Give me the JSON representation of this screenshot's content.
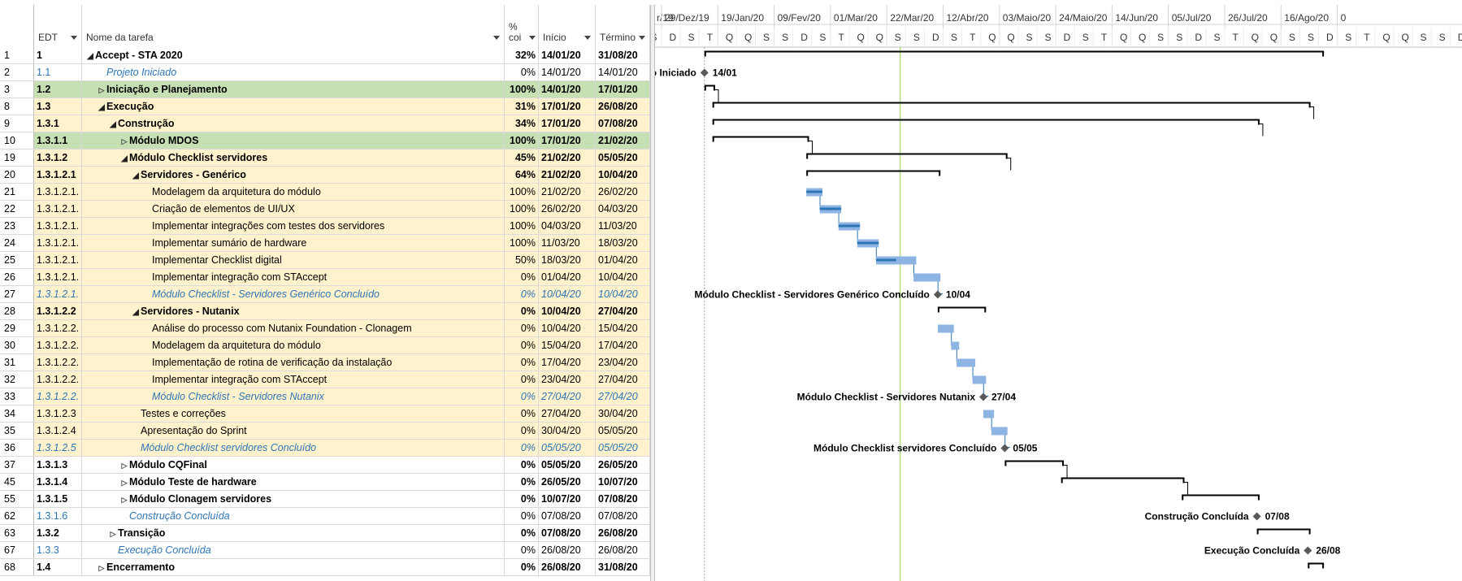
{
  "table": {
    "headers": {
      "id": "",
      "edt": "EDT",
      "name": "Nome da tarefa",
      "pct_top": "%",
      "pct_bottom": "coi",
      "start": "Início",
      "end": "Término"
    },
    "rows": [
      {
        "id": "1",
        "edt": "1",
        "name": "Accept - STA 2020",
        "pct": "32%",
        "start": "14/01/20",
        "end": "31/08/20",
        "level": 0,
        "bold": true,
        "expander": "open",
        "bg": "#ffffff",
        "type": "summary"
      },
      {
        "id": "2",
        "edt": "1.1",
        "name": "Projeto Iniciado",
        "pct": "0%",
        "start": "14/01/20",
        "end": "14/01/20",
        "level": 1,
        "bold": false,
        "expander": "",
        "bg": "#ffffff",
        "type": "milestone-plain"
      },
      {
        "id": "3",
        "edt": "1.2",
        "name": "Iniciação e Planejamento",
        "pct": "100%",
        "start": "14/01/20",
        "end": "17/01/20",
        "level": 1,
        "bold": true,
        "expander": "closed",
        "bg": "#c6e0b4",
        "type": "summary"
      },
      {
        "id": "8",
        "edt": "1.3",
        "name": "Execução",
        "pct": "31%",
        "start": "17/01/20",
        "end": "26/08/20",
        "level": 1,
        "bold": true,
        "expander": "open",
        "bg": "#fff2cc",
        "type": "summary"
      },
      {
        "id": "9",
        "edt": "1.3.1",
        "name": "Construção",
        "pct": "34%",
        "start": "17/01/20",
        "end": "07/08/20",
        "level": 2,
        "bold": true,
        "expander": "open",
        "bg": "#fff2cc",
        "type": "summary"
      },
      {
        "id": "10",
        "edt": "1.3.1.1",
        "name": "Módulo MDOS",
        "pct": "100%",
        "start": "17/01/20",
        "end": "21/02/20",
        "level": 3,
        "bold": true,
        "expander": "closed",
        "bg": "#c6e0b4",
        "type": "summary"
      },
      {
        "id": "19",
        "edt": "1.3.1.2",
        "name": "Módulo Checklist servidores",
        "pct": "45%",
        "start": "21/02/20",
        "end": "05/05/20",
        "level": 3,
        "bold": true,
        "expander": "open",
        "bg": "#fff2cc",
        "type": "summary"
      },
      {
        "id": "20",
        "edt": "1.3.1.2.1",
        "name": "Servidores - Genérico",
        "pct": "64%",
        "start": "21/02/20",
        "end": "10/04/20",
        "level": 4,
        "bold": true,
        "expander": "open",
        "bg": "#fff2cc",
        "type": "summary"
      },
      {
        "id": "21",
        "edt": "1.3.1.2.1.",
        "name": "Modelagem da arquitetura do módulo",
        "pct": "100%",
        "start": "21/02/20",
        "end": "26/02/20",
        "level": 5,
        "bold": false,
        "expander": "",
        "bg": "#fff2cc",
        "type": "task"
      },
      {
        "id": "22",
        "edt": "1.3.1.2.1.",
        "name": "Criação de elementos de UI/UX",
        "pct": "100%",
        "start": "26/02/20",
        "end": "04/03/20",
        "level": 5,
        "bold": false,
        "expander": "",
        "bg": "#fff2cc",
        "type": "task"
      },
      {
        "id": "23",
        "edt": "1.3.1.2.1.",
        "name": "Implementar integrações com testes dos servidores",
        "pct": "100%",
        "start": "04/03/20",
        "end": "11/03/20",
        "level": 5,
        "bold": false,
        "expander": "",
        "bg": "#fff2cc",
        "type": "task"
      },
      {
        "id": "24",
        "edt": "1.3.1.2.1.",
        "name": "Implementar sumário de hardware",
        "pct": "100%",
        "start": "11/03/20",
        "end": "18/03/20",
        "level": 5,
        "bold": false,
        "expander": "",
        "bg": "#fff2cc",
        "type": "task"
      },
      {
        "id": "25",
        "edt": "1.3.1.2.1.",
        "name": "Implementar Checklist digital",
        "pct": "50%",
        "start": "18/03/20",
        "end": "01/04/20",
        "level": 5,
        "bold": false,
        "expander": "",
        "bg": "#fff2cc",
        "type": "task"
      },
      {
        "id": "26",
        "edt": "1.3.1.2.1.",
        "name": "Implementar integração com STAccept",
        "pct": "0%",
        "start": "01/04/20",
        "end": "10/04/20",
        "level": 5,
        "bold": false,
        "expander": "",
        "bg": "#fff2cc",
        "type": "task"
      },
      {
        "id": "27",
        "edt": "1.3.1.2.1.",
        "name": "Módulo Checklist - Servidores Genérico Concluído",
        "pct": "0%",
        "start": "10/04/20",
        "end": "10/04/20",
        "level": 5,
        "bold": false,
        "expander": "",
        "bg": "#fff2cc",
        "type": "milestone"
      },
      {
        "id": "28",
        "edt": "1.3.1.2.2",
        "name": "Servidores - Nutanix",
        "pct": "0%",
        "start": "10/04/20",
        "end": "27/04/20",
        "level": 4,
        "bold": true,
        "expander": "open",
        "bg": "#fff2cc",
        "type": "summary"
      },
      {
        "id": "29",
        "edt": "1.3.1.2.2.",
        "name": "Análise do processo com Nutanix Foundation - Clonagem",
        "pct": "0%",
        "start": "10/04/20",
        "end": "15/04/20",
        "level": 5,
        "bold": false,
        "expander": "",
        "bg": "#fff2cc",
        "type": "task"
      },
      {
        "id": "30",
        "edt": "1.3.1.2.2.",
        "name": "Modelagem da arquitetura do módulo",
        "pct": "0%",
        "start": "15/04/20",
        "end": "17/04/20",
        "level": 5,
        "bold": false,
        "expander": "",
        "bg": "#fff2cc",
        "type": "task"
      },
      {
        "id": "31",
        "edt": "1.3.1.2.2.",
        "name": "Implementação de rotina de verificação da instalação",
        "pct": "0%",
        "start": "17/04/20",
        "end": "23/04/20",
        "level": 5,
        "bold": false,
        "expander": "",
        "bg": "#fff2cc",
        "type": "task"
      },
      {
        "id": "32",
        "edt": "1.3.1.2.2.",
        "name": "Implementar integração com STAccept",
        "pct": "0%",
        "start": "23/04/20",
        "end": "27/04/20",
        "level": 5,
        "bold": false,
        "expander": "",
        "bg": "#fff2cc",
        "type": "task"
      },
      {
        "id": "33",
        "edt": "1.3.1.2.2.",
        "name": "Módulo Checklist - Servidores Nutanix",
        "pct": "0%",
        "start": "27/04/20",
        "end": "27/04/20",
        "level": 5,
        "bold": false,
        "expander": "",
        "bg": "#fff2cc",
        "type": "milestone"
      },
      {
        "id": "34",
        "edt": "1.3.1.2.3",
        "name": "Testes e correções",
        "pct": "0%",
        "start": "27/04/20",
        "end": "30/04/20",
        "level": 4,
        "bold": false,
        "expander": "",
        "bg": "#fff2cc",
        "type": "task"
      },
      {
        "id": "35",
        "edt": "1.3.1.2.4",
        "name": "Apresentação do Sprint",
        "pct": "0%",
        "start": "30/04/20",
        "end": "05/05/20",
        "level": 4,
        "bold": false,
        "expander": "",
        "bg": "#fff2cc",
        "type": "task"
      },
      {
        "id": "36",
        "edt": "1.3.1.2.5",
        "name": "Módulo Checklist servidores Concluído",
        "pct": "0%",
        "start": "05/05/20",
        "end": "05/05/20",
        "level": 4,
        "bold": false,
        "expander": "",
        "bg": "#fff2cc",
        "type": "milestone"
      },
      {
        "id": "37",
        "edt": "1.3.1.3",
        "name": "Módulo CQFinal",
        "pct": "0%",
        "start": "05/05/20",
        "end": "26/05/20",
        "level": 3,
        "bold": true,
        "expander": "closed",
        "bg": "#ffffff",
        "type": "summary"
      },
      {
        "id": "45",
        "edt": "1.3.1.4",
        "name": "Módulo Teste de hardware",
        "pct": "0%",
        "start": "26/05/20",
        "end": "10/07/20",
        "level": 3,
        "bold": true,
        "expander": "closed",
        "bg": "#ffffff",
        "type": "summary"
      },
      {
        "id": "55",
        "edt": "1.3.1.5",
        "name": "Módulo Clonagem servidores",
        "pct": "0%",
        "start": "10/07/20",
        "end": "07/08/20",
        "level": 3,
        "bold": true,
        "expander": "closed",
        "bg": "#ffffff",
        "type": "summary"
      },
      {
        "id": "62",
        "edt": "1.3.1.6",
        "name": "Construção Concluída",
        "pct": "0%",
        "start": "07/08/20",
        "end": "07/08/20",
        "level": 3,
        "bold": false,
        "expander": "",
        "bg": "#ffffff",
        "type": "milestone-plain"
      },
      {
        "id": "63",
        "edt": "1.3.2",
        "name": "Transição",
        "pct": "0%",
        "start": "07/08/20",
        "end": "26/08/20",
        "level": 2,
        "bold": true,
        "expander": "closed",
        "bg": "#ffffff",
        "type": "summary"
      },
      {
        "id": "67",
        "edt": "1.3.3",
        "name": "Execução Concluída",
        "pct": "0%",
        "start": "26/08/20",
        "end": "26/08/20",
        "level": 2,
        "bold": false,
        "expander": "",
        "bg": "#ffffff",
        "type": "milestone-plain"
      },
      {
        "id": "68",
        "edt": "1.4",
        "name": "Encerramento",
        "pct": "0%",
        "start": "26/08/20",
        "end": "31/08/20",
        "level": 1,
        "bold": true,
        "expander": "closed",
        "bg": "#ffffff",
        "type": "summary"
      }
    ]
  },
  "timescale": {
    "top_labels": [
      "r/19",
      "29/Dez/19",
      "19/Jan/20",
      "09/Fev/20",
      "01/Mar/20",
      "22/Mar/20",
      "12/Abr/20",
      "03/Maio/20",
      "24/Maio/20",
      "14/Jun/20",
      "05/Jul/20",
      "26/Jul/20",
      "16/Ago/20",
      "0"
    ],
    "day_labels": [
      "Q",
      "S",
      "S",
      "D",
      "S",
      "T",
      "Q",
      "Q",
      "S",
      "S",
      "D",
      "S",
      "T",
      "Q",
      "Q",
      "S",
      "S",
      "D",
      "S",
      "T",
      "Q",
      "Q",
      "S",
      "S",
      "D",
      "S",
      "T",
      "Q",
      "Q",
      "S",
      "S",
      "D",
      "S",
      "T",
      "Q",
      "Q",
      "S",
      "S",
      "D",
      "S",
      "T",
      "Q",
      "Q",
      "S",
      "S",
      "D",
      "S",
      "T",
      "Q",
      "Q",
      "S",
      "S",
      "D",
      "S",
      "T",
      "Q",
      "Q",
      "S",
      "S",
      "D",
      "S",
      "T",
      "Q"
    ]
  },
  "gantt": {
    "project_start": "Projeto Iniciado",
    "project_start_date": "14/01",
    "ms_generico": "Módulo Checklist - Servidores Genérico Concluído",
    "ms_generico_date": "10/04",
    "ms_nutanix": "Módulo Checklist - Servidores Nutanix",
    "ms_nutanix_date": "27/04",
    "ms_checklist": "Módulo Checklist servidores Concluído",
    "ms_checklist_date": "05/05",
    "ms_construcao": "Construção Concluída",
    "ms_construcao_date": "07/08",
    "ms_execucao": "Execução Concluída",
    "ms_execucao_date": "26/08"
  },
  "colors": {
    "bar": "#8db4e2",
    "bar_progress": "#2e75b6",
    "summary": "#000000",
    "milestone": "#595959",
    "today_line": "#92d050",
    "green_row": "#c6e0b4",
    "yellow_row": "#fff2cc",
    "milestone_text": "#2e75b6"
  }
}
